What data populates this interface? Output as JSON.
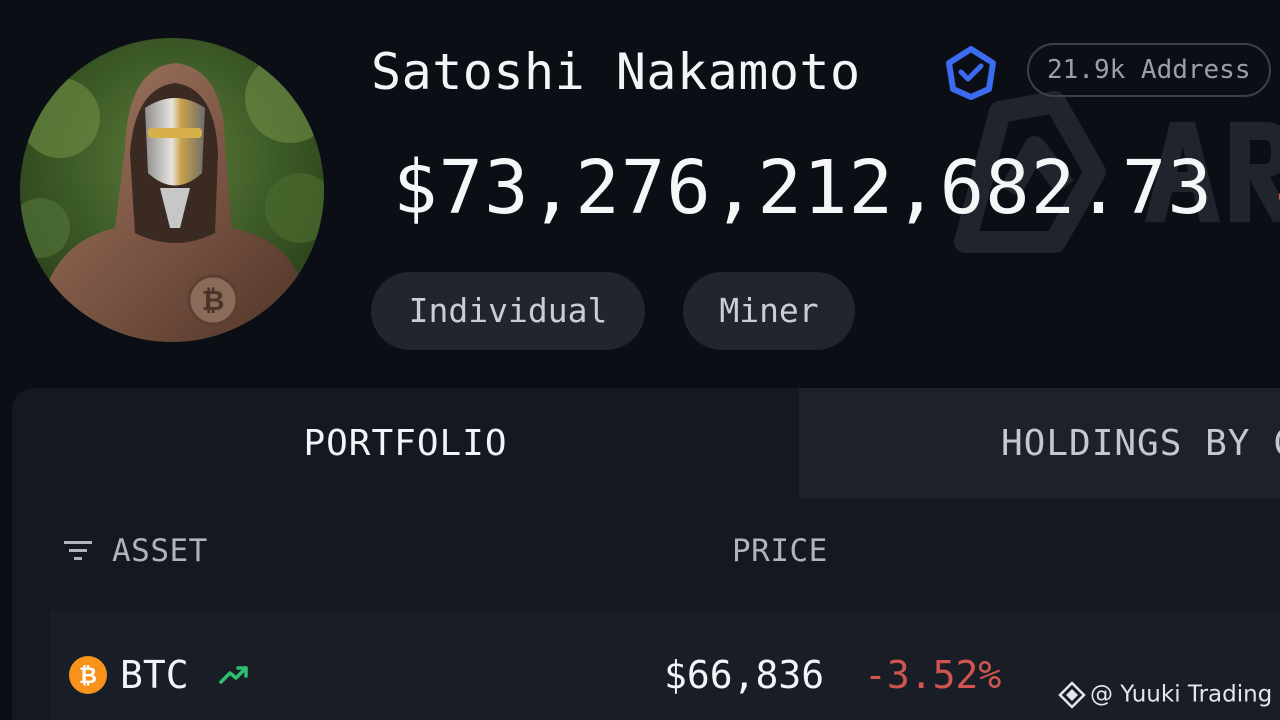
{
  "profile": {
    "name": "Satoshi Nakamoto",
    "address_count": "21.9k Address",
    "balance": "$73,276,212,682.73",
    "balance_change": "-",
    "tags": [
      "Individual",
      "Miner"
    ]
  },
  "tabs": [
    {
      "label": "PORTFOLIO",
      "active": true
    },
    {
      "label": "HOLDINGS BY C",
      "active": false
    }
  ],
  "table": {
    "headers": {
      "asset": "ASSET",
      "price": "PRICE"
    },
    "rows": [
      {
        "symbol": "BTC",
        "price": "$66,836",
        "change": "-3.52%"
      }
    ]
  },
  "credit": {
    "text": "@ Yuuki Trading"
  },
  "icons": {
    "verified": "verified-badge-icon",
    "filter": "filter-icon",
    "coin": "bitcoin-icon",
    "trend": "trend-up-icon",
    "credit_logo": "binance-square-icon"
  },
  "colors": {
    "background": "#0b0e15",
    "panel": "#141821",
    "negative": "#d1554f",
    "positive": "#2fbf71",
    "verified": "#3b6cf0",
    "bitcoin": "#f7931a"
  }
}
